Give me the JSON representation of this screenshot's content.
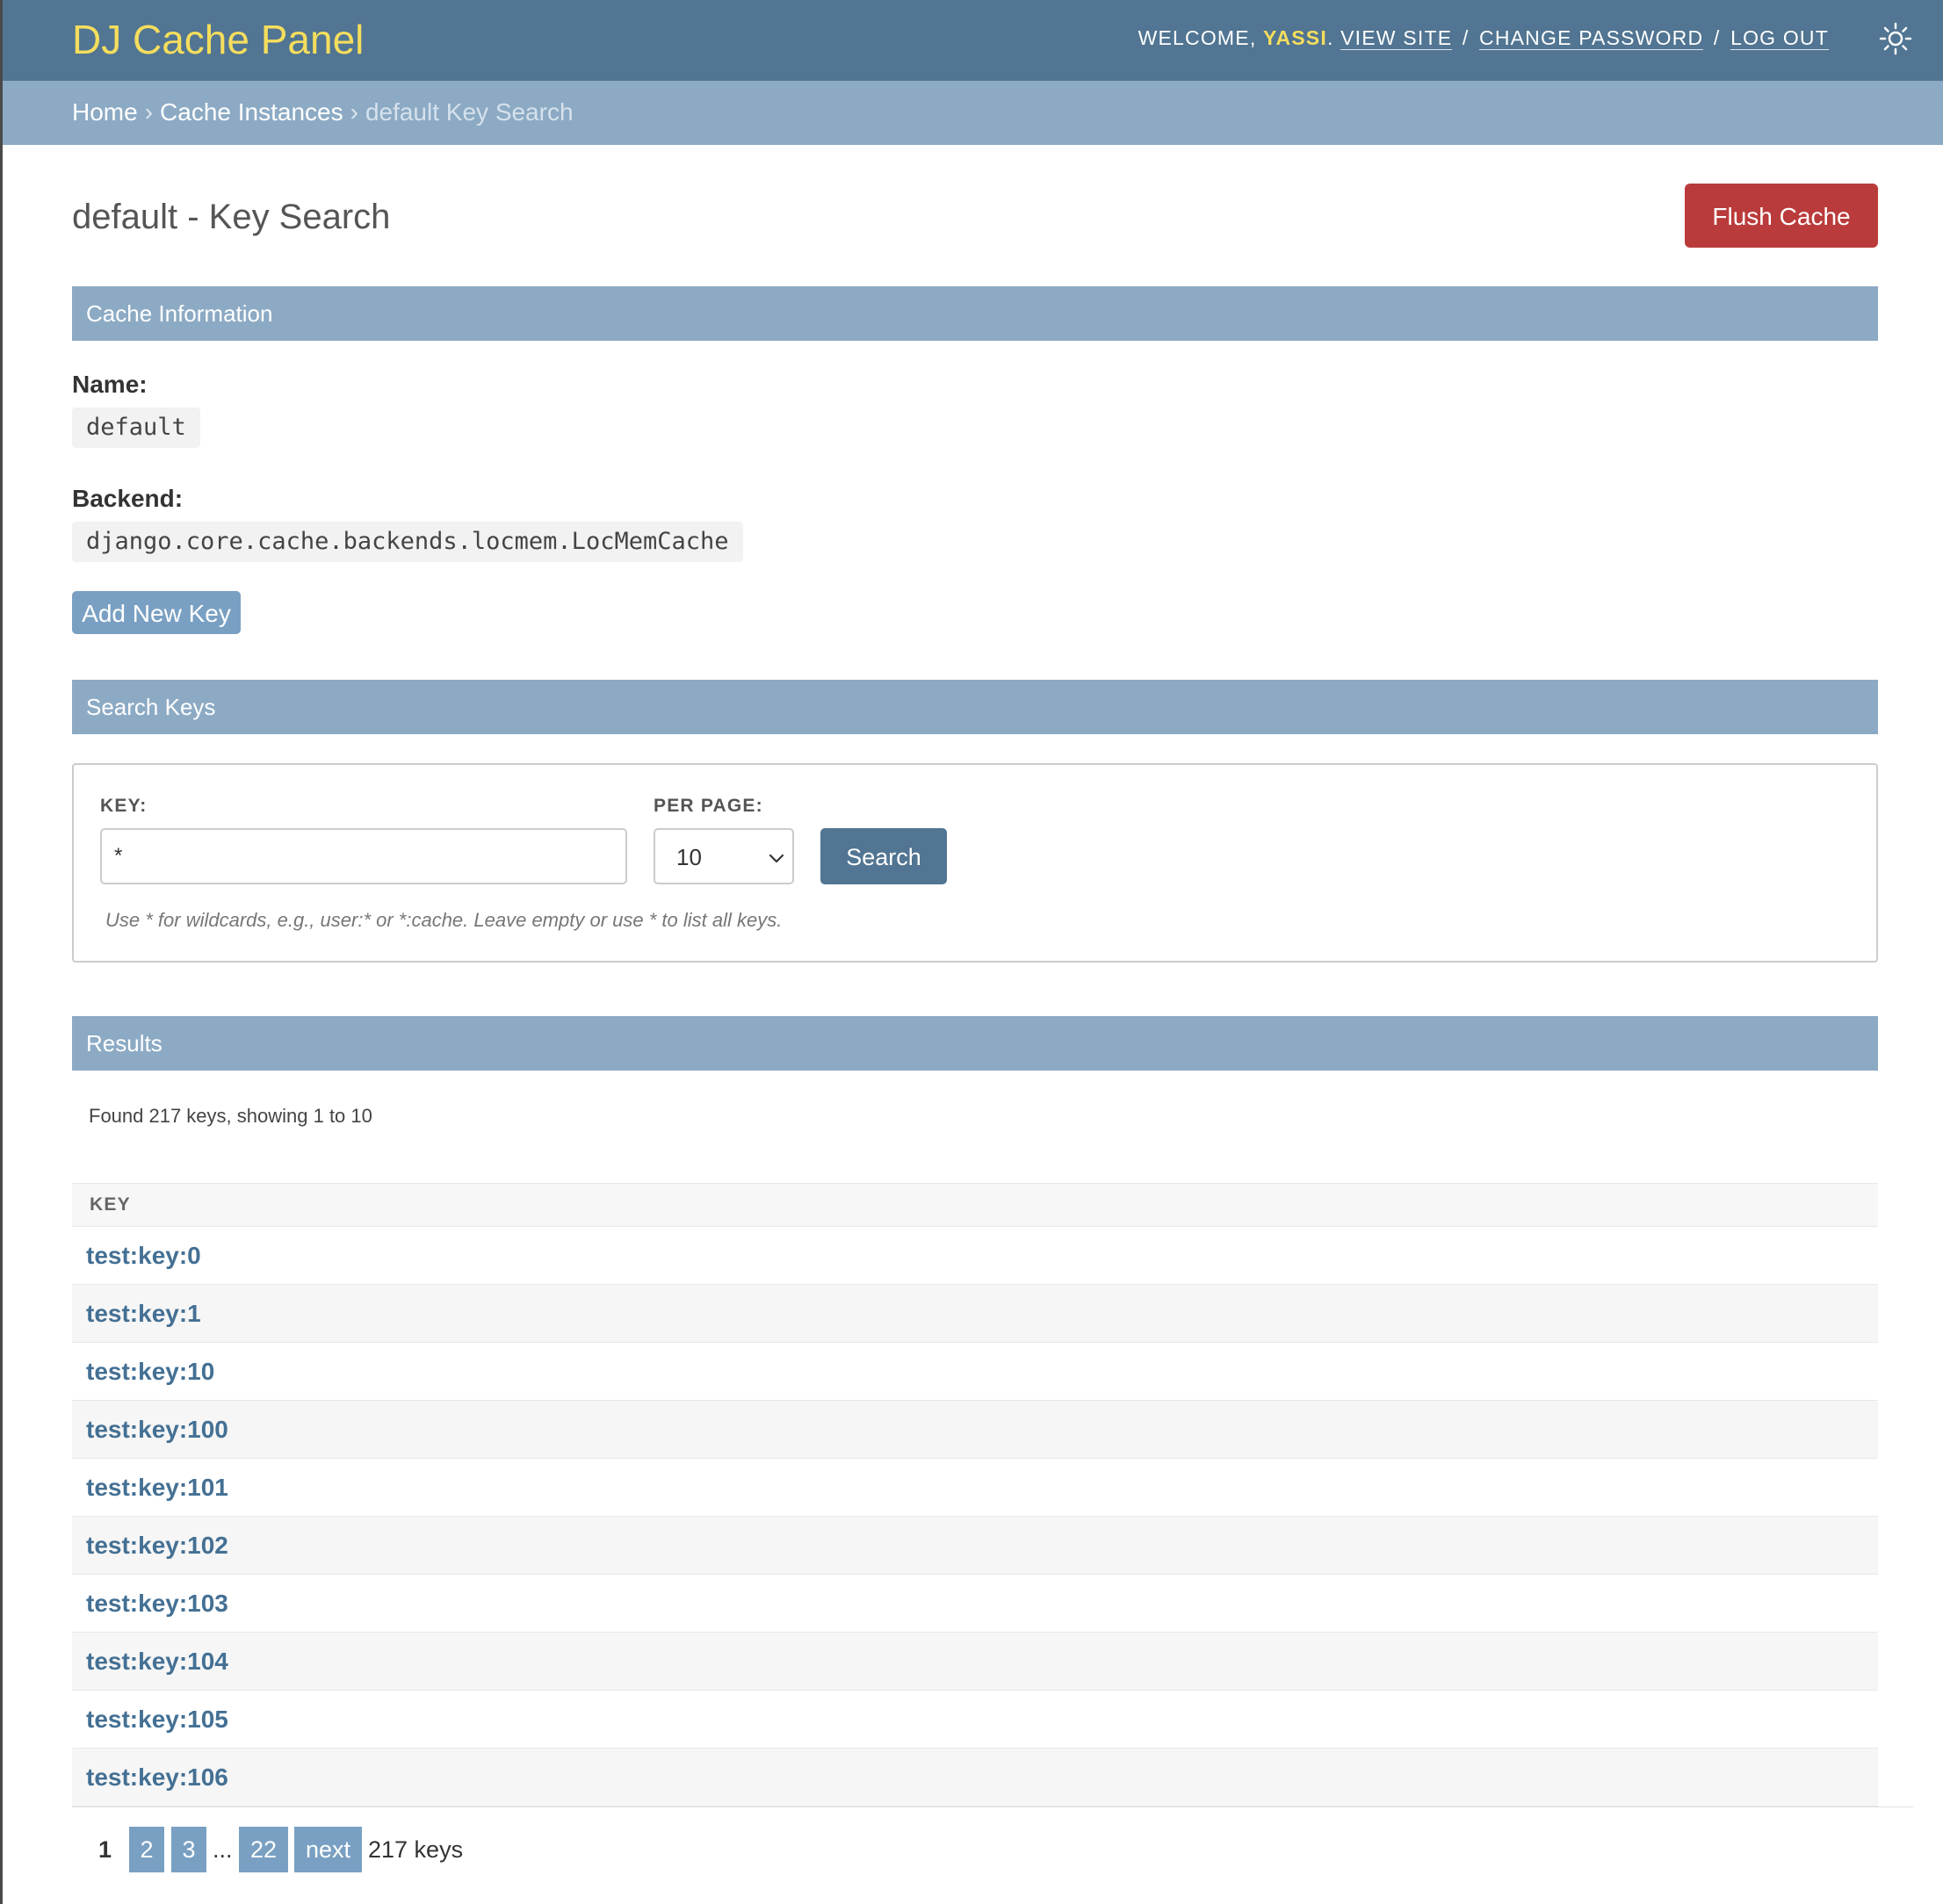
{
  "header": {
    "brand": "DJ Cache Panel",
    "welcome": "WELCOME,",
    "username": "YASSI",
    "username_suffix": ".",
    "view_site": "VIEW SITE",
    "separator": "/",
    "change_password": "CHANGE PASSWORD",
    "log_out": "LOG OUT",
    "theme_icon": "sun-icon"
  },
  "breadcrumbs": {
    "home": "Home",
    "cache_instances": "Cache Instances",
    "current": "default Key Search",
    "arrow": "›"
  },
  "page": {
    "title": "default - Key Search",
    "flush_button": "Flush Cache"
  },
  "cache_info": {
    "heading": "Cache Information",
    "name_label": "Name:",
    "name_value": "default",
    "backend_label": "Backend:",
    "backend_value": "django.core.cache.backends.locmem.LocMemCache",
    "add_key_button": "Add New Key"
  },
  "search": {
    "heading": "Search Keys",
    "key_label": "KEY:",
    "key_value": "*",
    "per_page_label": "PER PAGE:",
    "per_page_value": "10",
    "search_button": "Search",
    "help_text": "Use * for wildcards, e.g., user:* or *:cache. Leave empty or use * to list all keys."
  },
  "results": {
    "heading": "Results",
    "count_text": "Found 217 keys, showing 1 to 10",
    "column_header": "KEY",
    "rows": [
      "test:key:0",
      "test:key:1",
      "test:key:10",
      "test:key:100",
      "test:key:101",
      "test:key:102",
      "test:key:103",
      "test:key:104",
      "test:key:105",
      "test:key:106"
    ]
  },
  "pagination": {
    "current": "1",
    "page_2": "2",
    "page_3": "3",
    "ellipsis": "...",
    "last_page": "22",
    "next": "next",
    "total": "217 keys"
  },
  "colors": {
    "header_bg": "#517592",
    "breadcrumb_bg": "#8caac4",
    "brand": "#f5dd5d",
    "flush_button": "#ba3b3b",
    "link": "#447094"
  }
}
